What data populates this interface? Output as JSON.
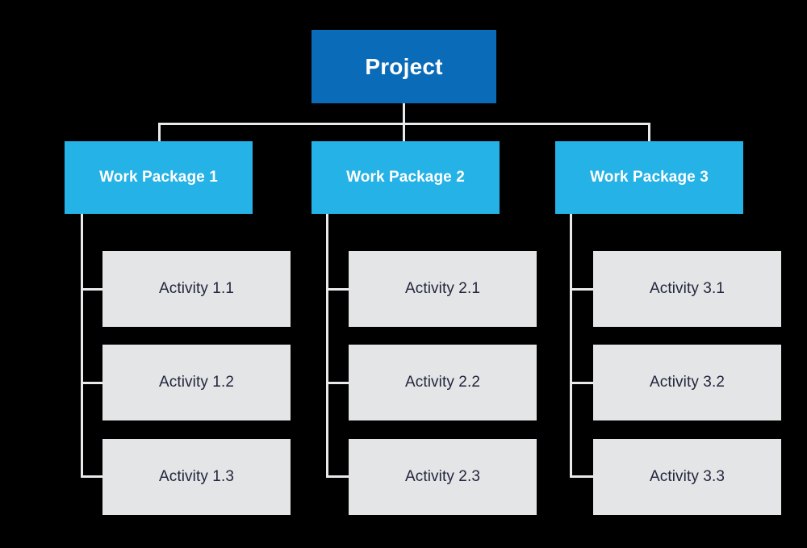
{
  "diagram": {
    "type": "work-breakdown-structure",
    "background_color": "#000000",
    "colors": {
      "root_fill": "#0a6cb8",
      "work_package_fill": "#25b2e6",
      "activity_fill": "#e4e5e7",
      "activity_text": "#22263c",
      "node_text_light": "#ffffff",
      "connector": "#e9eaec"
    },
    "root": {
      "label": "Project"
    },
    "work_packages": [
      {
        "label": "Work Package 1",
        "activities": [
          {
            "label": "Activity 1.1"
          },
          {
            "label": "Activity 1.2"
          },
          {
            "label": "Activity 1.3"
          }
        ]
      },
      {
        "label": "Work Package 2",
        "activities": [
          {
            "label": "Activity 2.1"
          },
          {
            "label": "Activity 2.2"
          },
          {
            "label": "Activity 2.3"
          }
        ]
      },
      {
        "label": "Work Package 3",
        "activities": [
          {
            "label": "Activity 3.1"
          },
          {
            "label": "Activity 3.2"
          },
          {
            "label": "Activity 3.3"
          }
        ]
      }
    ]
  }
}
